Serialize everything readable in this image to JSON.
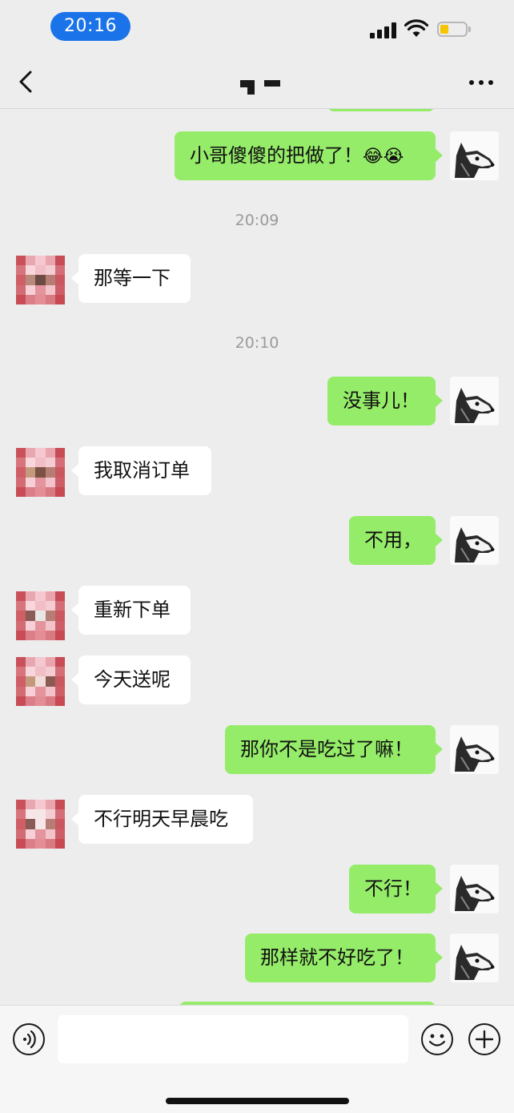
{
  "status_bar": {
    "time": "20:16"
  },
  "nav": {
    "back_icon": "chevron-left-icon",
    "more_icon": "ellipsis-icon"
  },
  "colors": {
    "outgoing_bubble": "#95ec69",
    "incoming_bubble": "#ffffff",
    "background": "#ededed",
    "time_pill": "#1a73e8"
  },
  "messages": [
    {
      "type": "outgoing",
      "text": "小哥傻傻的把做了！",
      "emoji": "😂😭"
    },
    {
      "type": "timestamp",
      "text": "20:09"
    },
    {
      "type": "incoming",
      "text": "那等一下"
    },
    {
      "type": "timestamp",
      "text": "20:10"
    },
    {
      "type": "outgoing",
      "text": "没事儿！"
    },
    {
      "type": "incoming",
      "text": "我取消订单"
    },
    {
      "type": "outgoing",
      "text": "不用，"
    },
    {
      "type": "incoming",
      "text": "重新下单"
    },
    {
      "type": "incoming",
      "text": "今天送呢"
    },
    {
      "type": "outgoing",
      "text": "那你不是吃过了嘛！"
    },
    {
      "type": "incoming",
      "text": "不行明天早晨吃"
    },
    {
      "type": "outgoing",
      "text": "不行！"
    },
    {
      "type": "outgoing",
      "text": "那样就不好吃了！"
    }
  ],
  "input_bar": {
    "placeholder": "",
    "voice_icon": "voice-icon",
    "emoji_icon": "smiley-icon",
    "plus_icon": "plus-icon"
  }
}
